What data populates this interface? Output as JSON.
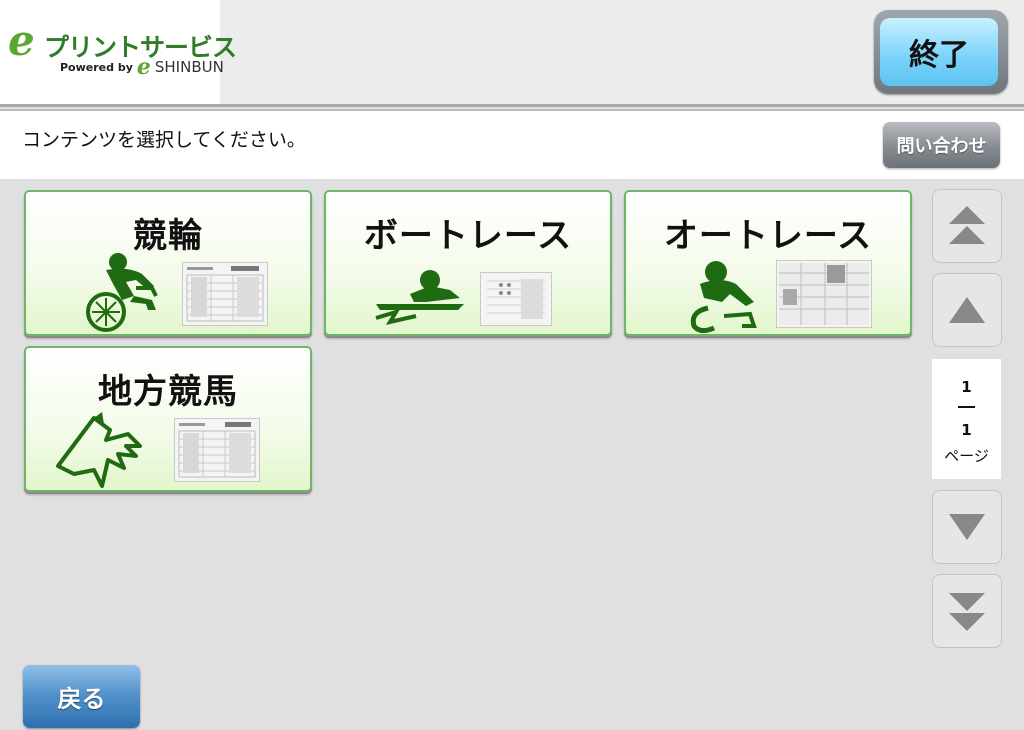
{
  "header": {
    "logo": {
      "title": "プリントサービス",
      "powered_by": "Powered by",
      "brand": "SHINBUN"
    },
    "exit_label": "終了"
  },
  "instruction": {
    "text": "コンテンツを選択してください。",
    "inquiry_label": "問い合わせ"
  },
  "contents": [
    {
      "label": "競輪",
      "icon": "cyclist-icon"
    },
    {
      "label": "ボートレース",
      "icon": "boat-racer-icon"
    },
    {
      "label": "オートレース",
      "icon": "motorcycle-racer-icon"
    },
    {
      "label": "地方競馬",
      "icon": "horse-head-icon"
    }
  ],
  "pagination": {
    "current": "1",
    "total": "1",
    "unit": "ページ"
  },
  "footer": {
    "back_label": "戻る"
  },
  "colors": {
    "logo_green": "#2f7d2a",
    "icon_green": "#1f6b12",
    "tile_border": "#6fb46a",
    "exit_button": "#7fd4fa",
    "back_button": "#4f8fc9",
    "inquiry_button": "#868b92"
  }
}
